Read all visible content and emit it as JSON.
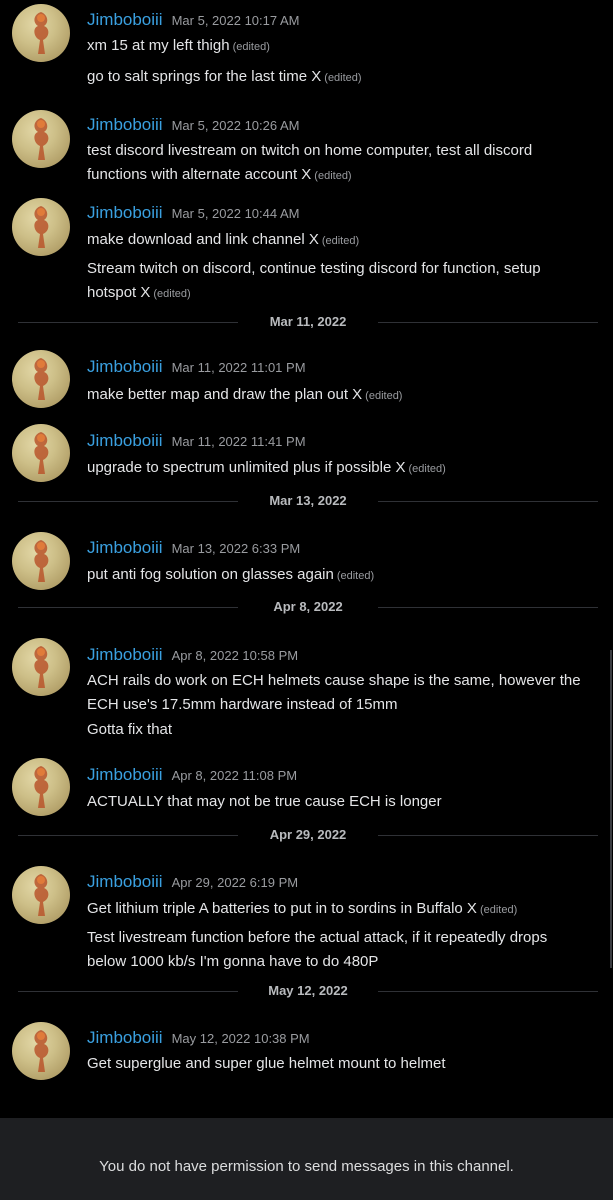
{
  "messages": [
    {
      "author": "Jimboboiii",
      "timestamp": "Mar 5, 2022 10:17 AM",
      "lines": [
        {
          "text": "xm 15 at my left thigh",
          "edited": "(edited)"
        },
        {
          "text": "go to salt springs for the last time X",
          "edited": "(edited)"
        }
      ]
    },
    {
      "author": "Jimboboiii",
      "timestamp": "Mar 5, 2022 10:26 AM",
      "lines": [
        {
          "text": "test discord livestream on twitch on home computer, test all discord",
          "edited": ""
        },
        {
          "text": "functions with alternate account X",
          "edited": "(edited)"
        }
      ]
    },
    {
      "author": "Jimboboiii",
      "timestamp": "Mar 5, 2022 10:44 AM",
      "lines": [
        {
          "text": "make download and link channel X",
          "edited": "(edited)"
        },
        {
          "text": "Stream twitch on discord, continue testing discord for function, setup",
          "edited": ""
        },
        {
          "text": "hotspot X",
          "edited": "(edited)"
        }
      ]
    },
    {
      "author": "Jimboboiii",
      "timestamp": "Mar 11, 2022 11:01 PM",
      "lines": [
        {
          "text": "make better map and draw the plan out X",
          "edited": "(edited)"
        }
      ]
    },
    {
      "author": "Jimboboiii",
      "timestamp": "Mar 11, 2022 11:41 PM",
      "lines": [
        {
          "text": "upgrade to spectrum unlimited plus if possible X",
          "edited": "(edited)"
        }
      ]
    },
    {
      "author": "Jimboboiii",
      "timestamp": "Mar 13, 2022 6:33 PM",
      "lines": [
        {
          "text": "put anti fog solution on glasses again",
          "edited": "(edited)"
        }
      ]
    },
    {
      "author": "Jimboboiii",
      "timestamp": "Apr 8, 2022 10:58 PM",
      "lines": [
        {
          "text": "ACH rails do work on ECH helmets cause shape is the same, however the",
          "edited": ""
        },
        {
          "text": "ECH use's 17.5mm hardware instead of 15mm",
          "edited": ""
        },
        {
          "text": "Gotta fix that",
          "edited": ""
        }
      ]
    },
    {
      "author": "Jimboboiii",
      "timestamp": "Apr 8, 2022 11:08 PM",
      "lines": [
        {
          "text": "ACTUALLY that may not be true cause ECH is longer",
          "edited": ""
        }
      ]
    },
    {
      "author": "Jimboboiii",
      "timestamp": "Apr 29, 2022 6:19 PM",
      "lines": [
        {
          "text": "Get lithium triple A batteries to put in to sordins in Buffalo X",
          "edited": "(edited)"
        },
        {
          "text": "Test livestream function before the actual attack, if it repeatedly drops",
          "edited": ""
        },
        {
          "text": "below 1000 kb/s I'm gonna have to do 480P",
          "edited": ""
        }
      ]
    },
    {
      "author": "Jimboboiii",
      "timestamp": "May 12, 2022 10:38 PM",
      "lines": [
        {
          "text": "Get superglue and super glue helmet mount to helmet",
          "edited": ""
        }
      ]
    }
  ],
  "dividers": [
    "Mar 11, 2022",
    "Mar 13, 2022",
    "Apr 8, 2022",
    "Apr 29, 2022",
    "May 12, 2022"
  ],
  "footer": {
    "notice": "You do not have permission to send messages in this channel."
  },
  "colors": {
    "username": "#3aa0e0",
    "background": "#000000",
    "footer_bg": "#1e1f22"
  }
}
